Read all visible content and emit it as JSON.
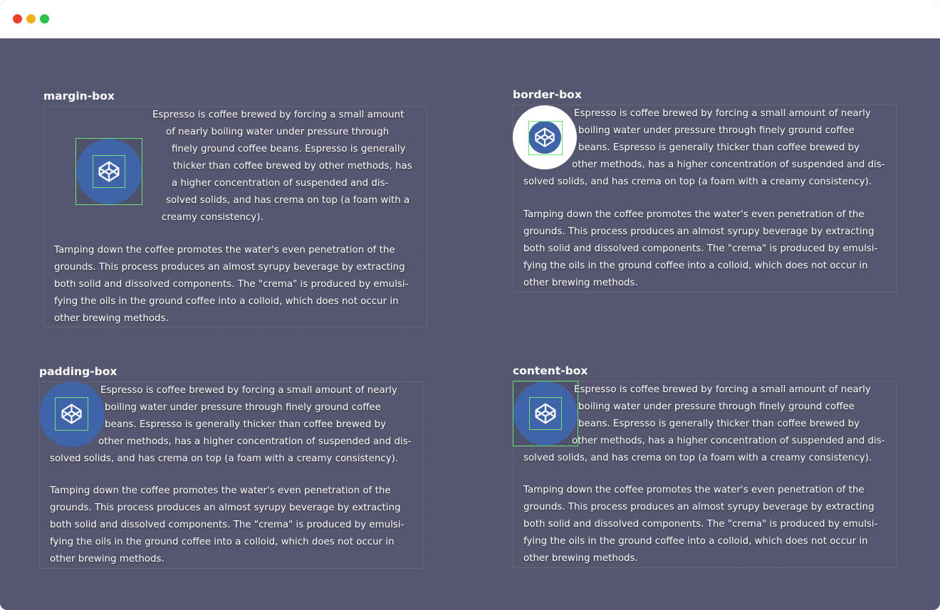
{
  "window": {
    "controls": [
      "close",
      "minimize",
      "maximize"
    ]
  },
  "colors": {
    "background": "#55566f",
    "circle": "#3f64a8",
    "outline": "#6ce37a",
    "text": "#ffffff"
  },
  "icons": [
    "codepen-logo-icon"
  ],
  "sections": {
    "margin_box": {
      "title": "margin-box",
      "p1": [
        "Espresso is coffee brewed by forcing a small amount",
        "of nearly boiling water under pressure through",
        "finely ground coffee beans. Espresso is generally",
        "thicker than coffee brewed by other methods, has",
        "a higher concentration of suspended and dis-",
        "solved solids, and has crema on top (a foam with a",
        "creamy consistency)."
      ],
      "p2": [
        "Tamping down the coffee promotes the water's even penetration of the",
        "grounds. This process produces an almost syrupy beverage by extracting",
        "both solid and dissolved components. The \"crema\" is produced by emulsi-",
        "fying the oils in the ground coffee into a colloid, which does not occur in",
        "other brewing methods."
      ]
    },
    "border_box": {
      "title": "border-box",
      "p1": [
        "Espresso is coffee brewed by forcing a small amount of nearly",
        "boiling water under pressure through finely ground coffee",
        "beans. Espresso is generally thicker than coffee brewed by",
        "other methods, has a higher concentration of suspended and dis-",
        "solved solids, and has crema on top (a foam with a creamy consistency)."
      ],
      "p2": [
        "Tamping down the coffee promotes the water's even penetration of the",
        "grounds. This process produces an almost syrupy beverage by extracting",
        "both solid and dissolved components. The \"crema\" is produced by emulsi-",
        "fying the oils in the ground coffee into a colloid, which does not occur in",
        "other brewing methods."
      ]
    },
    "padding_box": {
      "title": "padding-box",
      "p1": [
        "Espresso is coffee brewed by forcing a small amount of nearly",
        "boiling water under pressure through finely ground coffee",
        "beans. Espresso is generally thicker than coffee brewed by",
        "other methods, has a higher concentration of suspended and dis-",
        "solved solids, and has crema on top (a foam with a creamy consistency)."
      ],
      "p2": [
        "Tamping down the coffee promotes the water's even penetration of the",
        "grounds. This process produces an almost syrupy beverage by extracting",
        "both solid and dissolved components. The \"crema\" is produced by emulsi-",
        "fying the oils in the ground coffee into a colloid, which does not occur in",
        "other brewing methods."
      ]
    },
    "content_box": {
      "title": "content-box",
      "p1": [
        "Espresso is coffee brewed by forcing a small amount of nearly",
        "boiling water under pressure through finely ground coffee",
        "beans. Espresso is generally thicker than coffee brewed by",
        "other methods, has a higher concentration of suspended and dis-",
        "solved solids, and has crema on top (a foam with a creamy consistency)."
      ],
      "p2": [
        "Tamping down the coffee promotes the water's even penetration of the",
        "grounds. This process produces an almost syrupy beverage by extracting",
        "both solid and dissolved components. The \"crema\" is produced by emulsi-",
        "fying the oils in the ground coffee into a colloid, which does not occur in",
        "other brewing methods."
      ]
    }
  }
}
